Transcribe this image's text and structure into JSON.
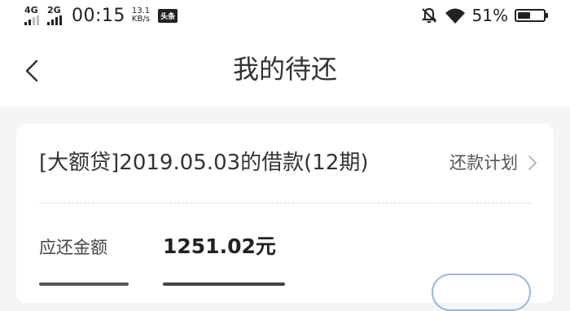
{
  "status_bar": {
    "net1": "4G",
    "net2": "2G",
    "time": "00:15",
    "speed_value": "13.1",
    "speed_unit": "KB/s",
    "app_badge": "头条",
    "battery_percent": "51%",
    "battery_level": 0.51,
    "icons": [
      "signal-icon",
      "mute-bell-icon",
      "wifi-icon",
      "battery-icon"
    ]
  },
  "nav": {
    "title": "我的待还",
    "back_icon": "chevron-left-icon"
  },
  "loan_card": {
    "title": "[大额贷]2019.05.03的借款(12期)",
    "plan_label": "还款计划",
    "plan_icon": "chevron-right-icon",
    "amount_label": "应还金额",
    "amount_value": "1251.02元"
  },
  "colors": {
    "background": "#f4f5f7",
    "card": "#ffffff",
    "text": "#333333",
    "pill_border": "#9cb8d8"
  }
}
